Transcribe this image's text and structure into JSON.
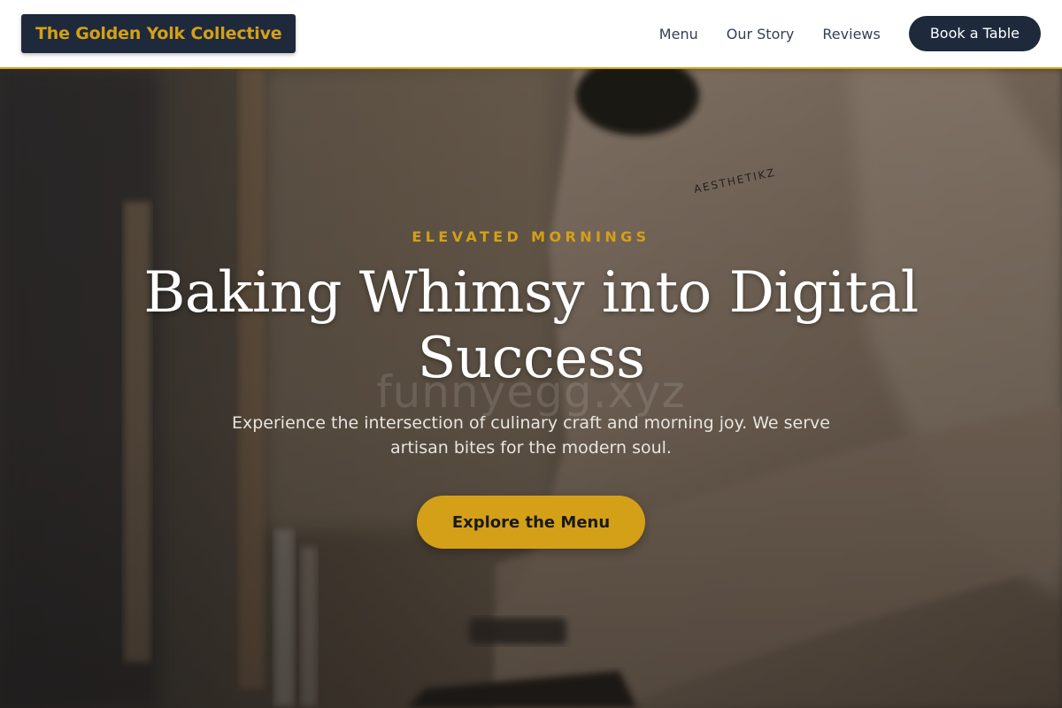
{
  "nav": {
    "logo": "The Golden Yolk Collective",
    "links": [
      "Menu",
      "Our Story",
      "Reviews"
    ],
    "cta": "Book a Table"
  },
  "hero": {
    "eyebrow": "ELEVATED MORNINGS",
    "title": "Baking Whimsy into Digital Success",
    "subtitle": "Experience the intersection of culinary craft and morning joy. We serve artisan bites for the modern soul.",
    "cta": "Explore the Menu",
    "watermark": "funnyegg.xyz",
    "photo_description": "blurred background photo of a person in a beige sweatshirt kneading dough"
  },
  "colors": {
    "accent": "#d4a017",
    "navy": "#1e293b",
    "text": "#334155"
  }
}
